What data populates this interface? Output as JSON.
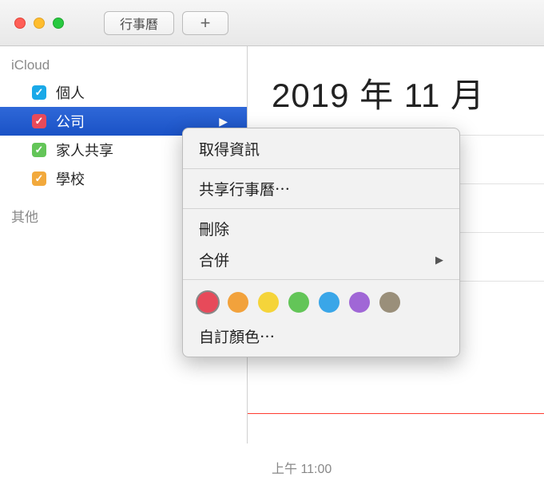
{
  "titlebar": {
    "calendars_button": "行事曆",
    "add_button": "+"
  },
  "sidebar": {
    "section_icloud": "iCloud",
    "section_other": "其他",
    "items": [
      {
        "label": "個人",
        "color": "#1aa9e8"
      },
      {
        "label": "公司",
        "color": "#e74a5a"
      },
      {
        "label": "家人共享",
        "color": "#63c558"
      },
      {
        "label": "學校",
        "color": "#f2a93c"
      }
    ]
  },
  "main": {
    "month_title": "2019 年 11 月",
    "time_label": "上午 11:00"
  },
  "context_menu": {
    "get_info": "取得資訊",
    "share": "共享行事曆⋯",
    "delete": "刪除",
    "merge": "合併",
    "custom_color": "自訂顏色⋯",
    "colors": [
      "#e74a5a",
      "#f2a23c",
      "#f5d43a",
      "#63c558",
      "#3aa6e8",
      "#a067d6",
      "#9a8f7a"
    ]
  }
}
